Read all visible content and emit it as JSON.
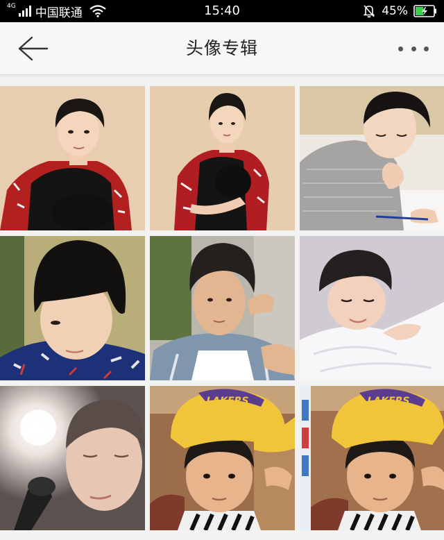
{
  "status_bar": {
    "network_type": "4G",
    "carrier": "中国联通",
    "time": "15:40",
    "battery_percent": "45%",
    "battery_level": 0.45
  },
  "nav_bar": {
    "title": "头像专辑",
    "back_icon": "arrow-left-icon",
    "more_icon": "more-dots-icon"
  },
  "grid": {
    "columns": 3,
    "cap_text": "LAKERS"
  }
}
